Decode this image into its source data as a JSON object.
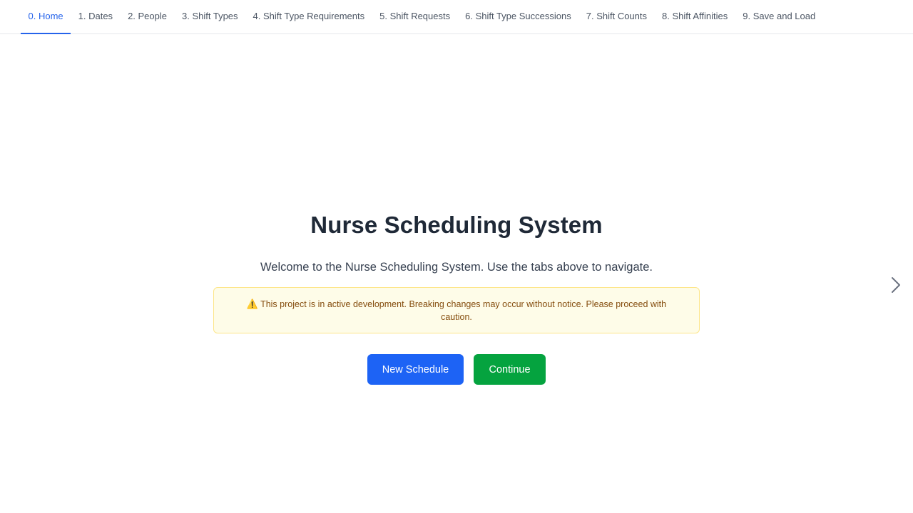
{
  "tabs": [
    {
      "label": "0. Home",
      "active": true
    },
    {
      "label": "1. Dates",
      "active": false
    },
    {
      "label": "2. People",
      "active": false
    },
    {
      "label": "3. Shift Types",
      "active": false
    },
    {
      "label": "4. Shift Type Requirements",
      "active": false
    },
    {
      "label": "5. Shift Requests",
      "active": false
    },
    {
      "label": "6. Shift Type Successions",
      "active": false
    },
    {
      "label": "7. Shift Counts",
      "active": false
    },
    {
      "label": "8. Shift Affinities",
      "active": false
    },
    {
      "label": "9. Save and Load",
      "active": false
    }
  ],
  "home": {
    "title": "Nurse Scheduling System",
    "subtitle": "Welcome to the Nurse Scheduling System. Use the tabs above to navigate.",
    "warning_icon": "⚠️",
    "warning_text": "This project is in active development. Breaking changes may occur without notice. Please proceed with caution.",
    "buttons": {
      "new_schedule": "New Schedule",
      "continue": "Continue"
    }
  },
  "icons": {
    "warning": "warning-icon",
    "next": "chevron-right-icon"
  },
  "colors": {
    "accent": "#2563eb",
    "primary_button": "#1d63f5",
    "success_button": "#05a33f",
    "warning_bg": "#fefce8",
    "warning_border": "#fde68a",
    "warning_text": "#854d0e"
  }
}
